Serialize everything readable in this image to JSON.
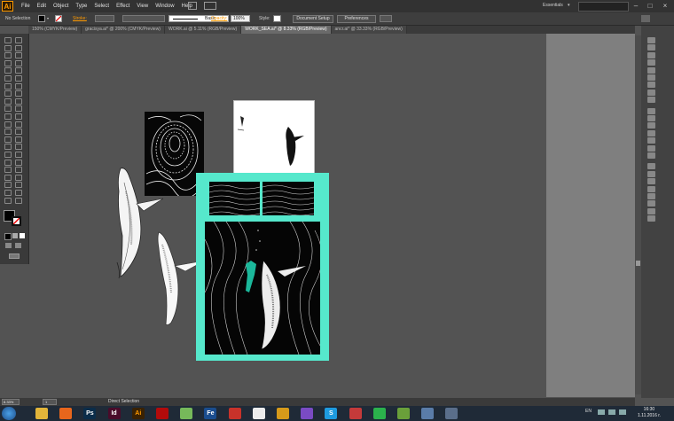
{
  "app": {
    "logo": "Ai"
  },
  "menu": {
    "items": [
      "File",
      "Edit",
      "Object",
      "Type",
      "Select",
      "Effect",
      "View",
      "Window",
      "Help"
    ]
  },
  "workspace": {
    "name": "Essentials"
  },
  "control_bar": {
    "selection": "No Selection",
    "stroke_label": "Stroke:",
    "brush_style": "Basic",
    "opacity_label": "Opacity:",
    "opacity_value": "100%",
    "style_label": "Style:",
    "document_setup": "Document Setup",
    "preferences": "Preferences"
  },
  "tabs": [
    {
      "label": "150% (CMYK/Preview)"
    },
    {
      "label": "gracisya.ai* @ 200% (CMYK/Preview)"
    },
    {
      "label": "WORK.ai @ 5.11% (RGB/Preview)"
    },
    {
      "label": "WORK_SEA.ai* @ 8.33% (RGB/Preview)",
      "active": true
    },
    {
      "label": "ancr.ai* @ 33.33% (RGB/Preview)"
    }
  ],
  "status": {
    "zoom": "8.33%",
    "page": "1",
    "tool": "Direct Selection"
  },
  "taskbar": {
    "apps": [
      {
        "icon": "folder-icon",
        "glyph": "",
        "color": "#e2b53a"
      },
      {
        "icon": "firefox-icon",
        "glyph": "",
        "color": "#e8661c"
      },
      {
        "icon": "photoshop-icon",
        "glyph": "Ps",
        "color": "#0b2d4a"
      },
      {
        "icon": "indesign-icon",
        "glyph": "Id",
        "color": "#4a0b2a"
      },
      {
        "icon": "illustrator-icon",
        "glyph": "Ai",
        "color": "#3a2203"
      },
      {
        "icon": "acrobat-icon",
        "glyph": "",
        "color": "#b30b0b"
      },
      {
        "icon": "pattern-icon",
        "glyph": "",
        "color": "#76b95a"
      },
      {
        "icon": "fe-icon",
        "glyph": "Fe",
        "color": "#1a4d8f"
      },
      {
        "icon": "red-app-icon",
        "glyph": "",
        "color": "#c8322a"
      },
      {
        "icon": "document-icon",
        "glyph": "",
        "color": "#ececec"
      },
      {
        "icon": "winamp-icon",
        "glyph": "",
        "color": "#d69a1a"
      },
      {
        "icon": "viber-icon",
        "glyph": "",
        "color": "#7a4bc4"
      },
      {
        "icon": "skype-icon",
        "glyph": "S",
        "color": "#1e9be0"
      },
      {
        "icon": "photos-icon",
        "glyph": "",
        "color": "#c43a3a"
      },
      {
        "icon": "spotify-icon",
        "glyph": "",
        "color": "#2bb24c"
      },
      {
        "icon": "media-icon",
        "glyph": "",
        "color": "#6aa03a"
      },
      {
        "icon": "monitor-icon",
        "glyph": "",
        "color": "#5a7ca8"
      },
      {
        "icon": "screen-icon",
        "glyph": "",
        "color": "#5a6e8a"
      }
    ],
    "language": "EN",
    "time": "16:30",
    "date": "1.11.2016 г."
  },
  "colors": {
    "accent": "#ff9a00",
    "frame": "#56e8cc",
    "canvas": "#535353"
  }
}
